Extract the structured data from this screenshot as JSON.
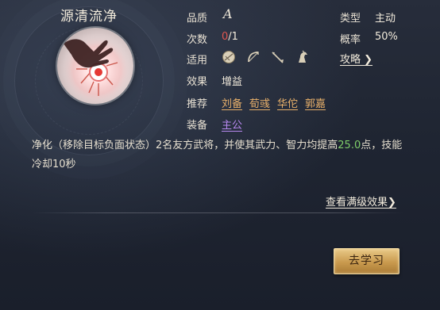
{
  "skill": {
    "name": "源清流净",
    "quality_label": "品质",
    "quality_value": "A",
    "type_label": "类型",
    "type_value": "主动",
    "count_label": "次数",
    "count_current": "0",
    "count_total": "/1",
    "rate_label": "概率",
    "rate_value": "50%",
    "applicable_label": "适用",
    "applicable_icons": [
      "shield-icon",
      "bow-icon",
      "spear-icon",
      "horse-icon"
    ],
    "strategy_label": "攻略",
    "effect_label": "效果",
    "effect_value": "增益",
    "recommend_label": "推荐",
    "recommend": [
      "刘备",
      "荀彧",
      "华佗",
      "郭嘉"
    ],
    "equip_label": "装备",
    "equip_value": "主公",
    "desc_part1": "净化（移除目标负面状态）2名友方武将，并使其武力、智力均提高",
    "desc_highlight": "25.0",
    "desc_part2": "点，技能冷却10秒",
    "full_effect_label": "查看满级效果",
    "learn_button": "去学习"
  },
  "colors": {
    "accent_gold": "#e8b06a",
    "accent_purple": "#b889f0",
    "count_red": "#e0564f",
    "highlight_green": "#7fcf6a"
  }
}
